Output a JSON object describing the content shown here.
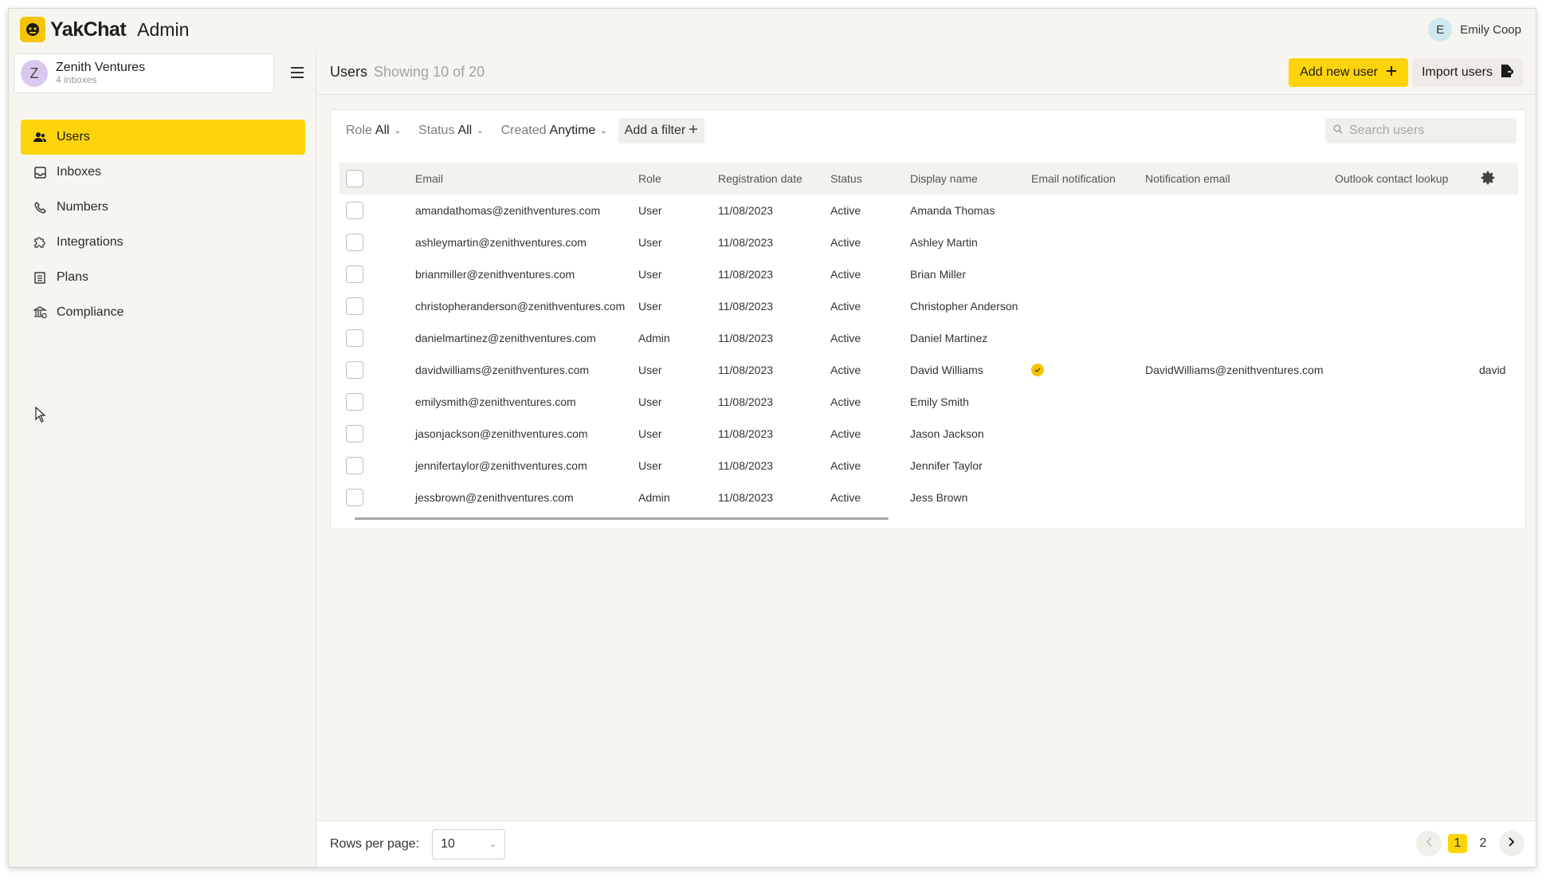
{
  "app": {
    "brand": "YakChat",
    "section": "Admin"
  },
  "user": {
    "initial": "E",
    "name": "Emily Coop"
  },
  "org": {
    "initial": "Z",
    "name": "Zenith Ventures",
    "sub": "4 inboxes"
  },
  "nav": [
    {
      "label": "Users",
      "icon": "users-icon",
      "active": true
    },
    {
      "label": "Inboxes",
      "icon": "inbox-icon",
      "active": false
    },
    {
      "label": "Numbers",
      "icon": "phone-icon",
      "active": false
    },
    {
      "label": "Integrations",
      "icon": "puzzle-icon",
      "active": false
    },
    {
      "label": "Plans",
      "icon": "plan-icon",
      "active": false
    },
    {
      "label": "Compliance",
      "icon": "bank-icon",
      "active": false
    }
  ],
  "header": {
    "title": "Users",
    "count": "Showing 10 of 20",
    "add_label": "Add new user",
    "import_label": "Import users"
  },
  "filters": {
    "role": {
      "label": "Role",
      "value": "All"
    },
    "status": {
      "label": "Status",
      "value": "All"
    },
    "created": {
      "label": "Created",
      "value": "Anytime"
    },
    "add": "Add a filter"
  },
  "search": {
    "placeholder": "Search users"
  },
  "table": {
    "columns": [
      "Email",
      "Role",
      "Registration date",
      "Status",
      "Display name",
      "Email notification",
      "Notification email",
      "Outlook contact lookup"
    ],
    "rows": [
      {
        "email": "amandathomas@zenithventures.com",
        "role": "User",
        "date": "11/08/2023",
        "status": "Active",
        "name": "Amanda Thomas",
        "notif": false,
        "notif_email": "",
        "extra": ""
      },
      {
        "email": "ashleymartin@zenithventures.com",
        "role": "User",
        "date": "11/08/2023",
        "status": "Active",
        "name": "Ashley Martin",
        "notif": false,
        "notif_email": "",
        "extra": ""
      },
      {
        "email": "brianmiller@zenithventures.com",
        "role": "User",
        "date": "11/08/2023",
        "status": "Active",
        "name": "Brian Miller",
        "notif": false,
        "notif_email": "",
        "extra": ""
      },
      {
        "email": "christopheranderson@zenithventures.com",
        "role": "User",
        "date": "11/08/2023",
        "status": "Active",
        "name": "Christopher Anderson",
        "notif": false,
        "notif_email": "",
        "extra": ""
      },
      {
        "email": "danielmartinez@zenithventures.com",
        "role": "Admin",
        "date": "11/08/2023",
        "status": "Active",
        "name": "Daniel Martinez",
        "notif": false,
        "notif_email": "",
        "extra": ""
      },
      {
        "email": "davidwilliams@zenithventures.com",
        "role": "User",
        "date": "11/08/2023",
        "status": "Active",
        "name": "David Williams",
        "notif": true,
        "notif_email": "DavidWilliams@zenithventures.com",
        "extra": "david"
      },
      {
        "email": "emilysmith@zenithventures.com",
        "role": "User",
        "date": "11/08/2023",
        "status": "Active",
        "name": "Emily Smith",
        "notif": false,
        "notif_email": "",
        "extra": ""
      },
      {
        "email": "jasonjackson@zenithventures.com",
        "role": "User",
        "date": "11/08/2023",
        "status": "Active",
        "name": "Jason Jackson",
        "notif": false,
        "notif_email": "",
        "extra": ""
      },
      {
        "email": "jennifertaylor@zenithventures.com",
        "role": "User",
        "date": "11/08/2023",
        "status": "Active",
        "name": "Jennifer Taylor",
        "notif": false,
        "notif_email": "",
        "extra": ""
      },
      {
        "email": "jessbrown@zenithventures.com",
        "role": "Admin",
        "date": "11/08/2023",
        "status": "Active",
        "name": "Jess Brown",
        "notif": false,
        "notif_email": "",
        "extra": ""
      }
    ]
  },
  "footer": {
    "rows_label": "Rows per page:",
    "rows_value": "10",
    "pages": [
      "1",
      "2"
    ],
    "current_page": "1"
  },
  "colors": {
    "accent": "#fdd40a",
    "background": "#f7f5f0"
  }
}
